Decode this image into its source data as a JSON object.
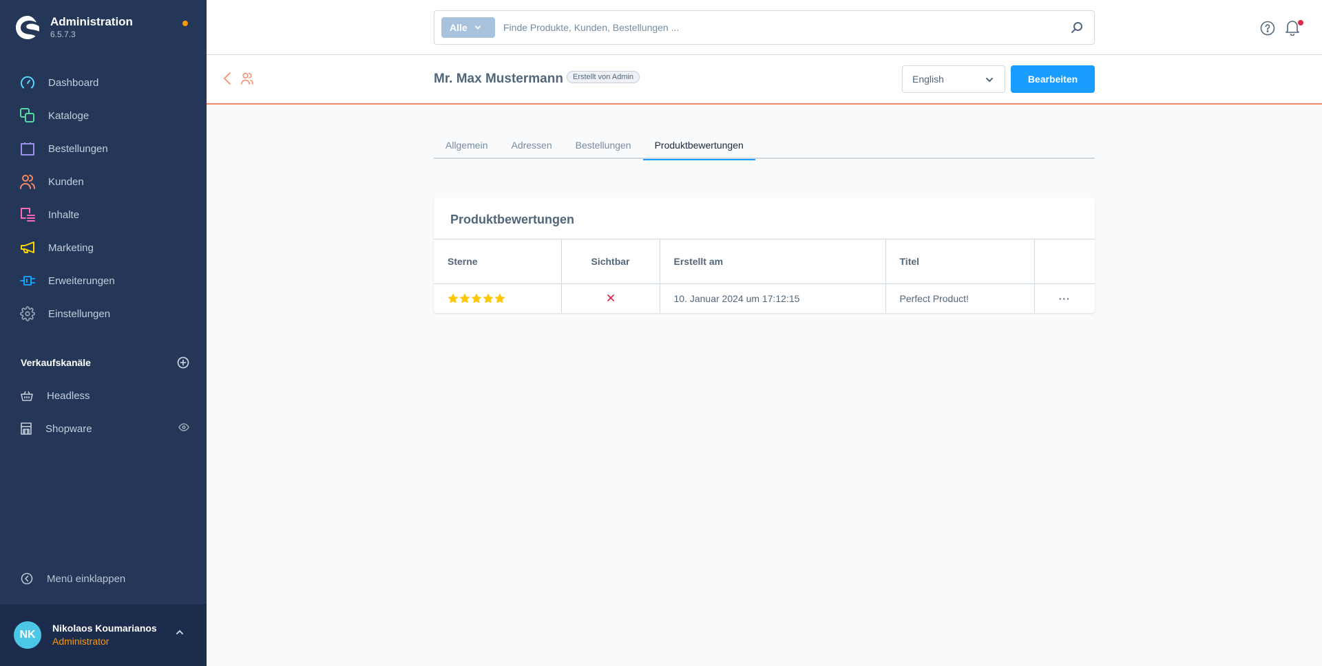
{
  "app": {
    "title": "Administration",
    "version": "6.5.7.3",
    "status_dot_color": "#ff9800"
  },
  "sidebar": {
    "items": [
      {
        "label": "Dashboard",
        "icon": "dashboard-icon",
        "color": "#57d9ff"
      },
      {
        "label": "Kataloge",
        "icon": "catalog-icon",
        "color": "#57d9a3"
      },
      {
        "label": "Bestellungen",
        "icon": "shopping-bag-icon",
        "color": "#a092f0"
      },
      {
        "label": "Kunden",
        "icon": "customers-icon",
        "color": "#f88962"
      },
      {
        "label": "Inhalte",
        "icon": "content-icon",
        "color": "#ff68b4"
      },
      {
        "label": "Marketing",
        "icon": "megaphone-icon",
        "color": "#ffd700"
      },
      {
        "label": "Erweiterungen",
        "icon": "plug-icon",
        "color": "#189eff"
      },
      {
        "label": "Einstellungen",
        "icon": "gear-icon",
        "color": "#9aa8b5"
      }
    ],
    "sales_channels": {
      "title": "Verkaufskanäle",
      "items": [
        {
          "label": "Headless",
          "icon": "basket-icon"
        },
        {
          "label": "Shopware",
          "icon": "storefront-icon"
        }
      ]
    },
    "collapse_label": "Menü einklappen",
    "user": {
      "initials": "NK",
      "name": "Nikolaos Koumarianos",
      "role": "Administrator"
    }
  },
  "search": {
    "type_label": "Alle",
    "placeholder": "Finde Produkte, Kunden, Bestellungen ...",
    "value": ""
  },
  "smartbar": {
    "title": "Mr. Max Mustermann",
    "badge": "Erstellt von Admin",
    "language": "English",
    "edit_label": "Bearbeiten"
  },
  "tabs": [
    {
      "label": "Allgemein",
      "active": false
    },
    {
      "label": "Adressen",
      "active": false
    },
    {
      "label": "Bestellungen",
      "active": false
    },
    {
      "label": "Produktbewertungen",
      "active": true
    }
  ],
  "reviews": {
    "title": "Produktbewertungen",
    "columns": [
      "Sterne",
      "Sichtbar",
      "Erstellt am",
      "Titel",
      ""
    ],
    "rows": [
      {
        "stars": 5,
        "max_stars": 5,
        "visible": false,
        "created_at": "10. Januar 2024 um 17:12:15",
        "title": "Perfect Product!",
        "actions_label": "···"
      }
    ]
  },
  "colors": {
    "sidebar_bg": "#243758",
    "accent": "#189eff",
    "smartbar_border": "#f88962",
    "star": "#ffc700",
    "invisible_x": "#de294c"
  }
}
